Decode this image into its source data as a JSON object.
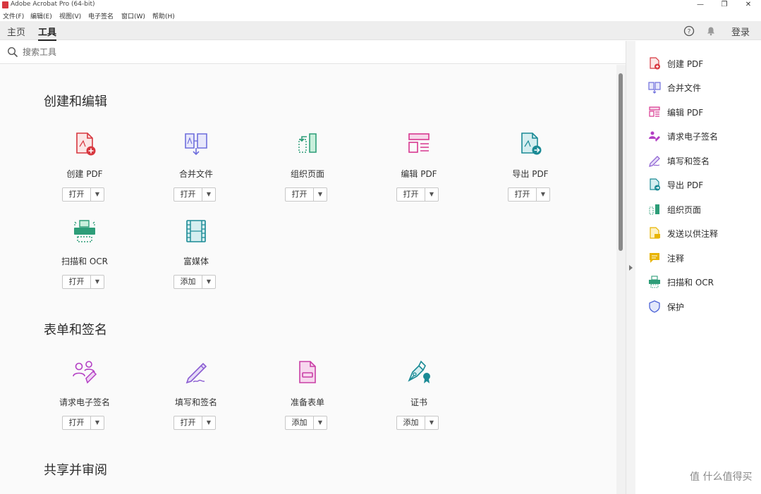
{
  "window": {
    "title": "Adobe Acrobat Pro (64-bit)",
    "controls": {
      "minimize": "—",
      "maximize": "❐",
      "close": "✕"
    }
  },
  "menu": [
    "文件(F)",
    "编辑(E)",
    "视图(V)",
    "电子签名",
    "窗口(W)",
    "帮助(H)"
  ],
  "tabs": {
    "home": "主页",
    "tools": "工具"
  },
  "topbar": {
    "signin": "登录",
    "help_icon": "help-icon",
    "bell_icon": "bell-icon"
  },
  "search": {
    "placeholder": "搜索工具",
    "value": ""
  },
  "sections": {
    "create_edit": {
      "title": "创建和编辑",
      "tools": [
        {
          "label": "创建 PDF",
          "button": "打开",
          "icon": "create-pdf-icon",
          "color": "#d7373f"
        },
        {
          "label": "合并文件",
          "button": "打开",
          "icon": "combine-files-icon",
          "color": "#6e6edc"
        },
        {
          "label": "组织页面",
          "button": "打开",
          "icon": "organize-pages-icon",
          "color": "#2d9d78"
        },
        {
          "label": "编辑 PDF",
          "button": "打开",
          "icon": "edit-pdf-icon",
          "color": "#d83790"
        },
        {
          "label": "导出 PDF",
          "button": "打开",
          "icon": "export-pdf-icon",
          "color": "#1a8a95"
        },
        {
          "label": "扫描和 OCR",
          "button": "打开",
          "icon": "scan-ocr-icon",
          "color": "#2d9d78"
        },
        {
          "label": "富媒体",
          "button": "添加",
          "icon": "rich-media-icon",
          "color": "#1a8a95"
        }
      ]
    },
    "forms_sign": {
      "title": "表单和签名",
      "tools": [
        {
          "label": "请求电子签名",
          "button": "打开",
          "icon": "request-esign-icon",
          "color": "#b33fc4"
        },
        {
          "label": "填写和签名",
          "button": "打开",
          "icon": "fill-sign-icon",
          "color": "#8a5cd1"
        },
        {
          "label": "准备表单",
          "button": "添加",
          "icon": "prepare-form-icon",
          "color": "#c93fa6"
        },
        {
          "label": "证书",
          "button": "添加",
          "icon": "certificate-icon",
          "color": "#1a8a95"
        }
      ]
    },
    "share_review": {
      "title": "共享并审阅"
    }
  },
  "right_pane": {
    "items": [
      {
        "label": "创建 PDF",
        "icon": "create-pdf-icon",
        "color": "#d7373f"
      },
      {
        "label": "合并文件",
        "icon": "combine-files-icon",
        "color": "#6e6edc"
      },
      {
        "label": "编辑 PDF",
        "icon": "edit-pdf-icon",
        "color": "#d83790"
      },
      {
        "label": "请求电子签名",
        "icon": "request-esign-icon",
        "color": "#b33fc4"
      },
      {
        "label": "填写和签名",
        "icon": "fill-sign-icon",
        "color": "#8a5cd1"
      },
      {
        "label": "导出 PDF",
        "icon": "export-pdf-icon",
        "color": "#1a8a95"
      },
      {
        "label": "组织页面",
        "icon": "organize-pages-icon",
        "color": "#2d9d78"
      },
      {
        "label": "发送以供注释",
        "icon": "send-comment-icon",
        "color": "#e8b400"
      },
      {
        "label": "注释",
        "icon": "comment-icon",
        "color": "#e8b400"
      },
      {
        "label": "扫描和 OCR",
        "icon": "scan-ocr-icon",
        "color": "#2d9d78"
      },
      {
        "label": "保护",
        "icon": "protect-icon",
        "color": "#4b62d6"
      }
    ]
  },
  "watermark": "值 什么值得买"
}
